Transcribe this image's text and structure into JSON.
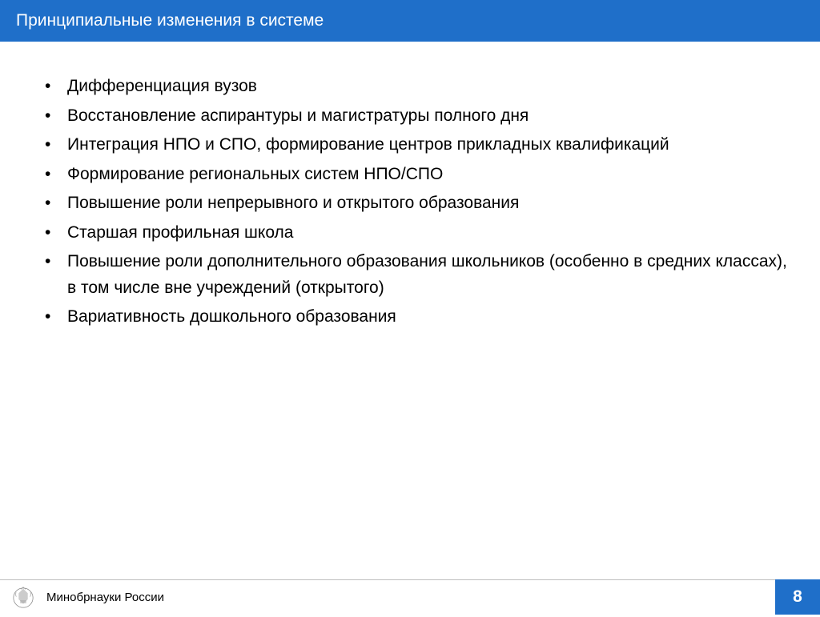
{
  "header": {
    "title": "Принципиальные изменения в системе"
  },
  "bullets": [
    {
      "text": "Дифференциация вузов",
      "justify": false
    },
    {
      "text": "Восстановление аспирантуры и магистратуры полного дня",
      "justify": false
    },
    {
      "text": "Интеграция НПО и СПО, формирование центров прикладных квалификаций",
      "justify": true
    },
    {
      "text": "Формирование региональных систем НПО/СПО",
      "justify": false
    },
    {
      "text": "Повышение роли непрерывного и открытого образования",
      "justify": false
    },
    {
      "text": "Старшая профильная школа",
      "justify": false
    },
    {
      "text": "Повышение роли дополнительного образования школьников (особенно в средних классах), в том числе вне учреждений (открытого)",
      "justify": false
    },
    {
      "text": "Вариативность дошкольного образования",
      "justify": false
    }
  ],
  "footer": {
    "label": "Минобрнауки России",
    "page_number": "8"
  }
}
